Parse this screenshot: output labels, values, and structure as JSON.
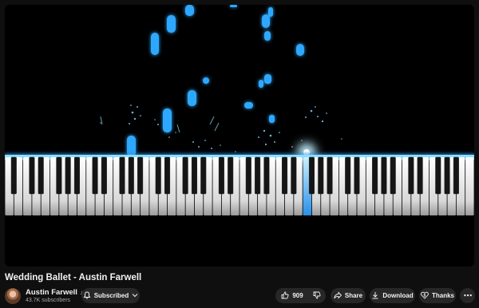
{
  "video": {
    "title": "Wedding Ballet - Austin Farwell"
  },
  "channel": {
    "name": "Austin Farwell",
    "verified_icon": "music-note-icon",
    "subscribers": "43.7K subscribers"
  },
  "actions": {
    "subscribe_label": "Subscribed",
    "like_count": "909",
    "share_label": "Share",
    "download_label": "Download",
    "thanks_label": "Thanks"
  },
  "icons": {
    "bell": "bell-icon",
    "chevron": "chevron-down-icon",
    "like": "thumbs-up-icon",
    "dislike": "thumbs-down-icon",
    "share": "share-arrow-icon",
    "download": "download-icon",
    "thanks": "heart-dollar-icon",
    "more": "more-horizontal-icon"
  },
  "colors": {
    "background": "#0f0f0f",
    "pill": "#272727",
    "note_glow": "#2fa8ff",
    "text_primary": "#f1f1f1",
    "text_secondary": "#aaaaaa"
  }
}
